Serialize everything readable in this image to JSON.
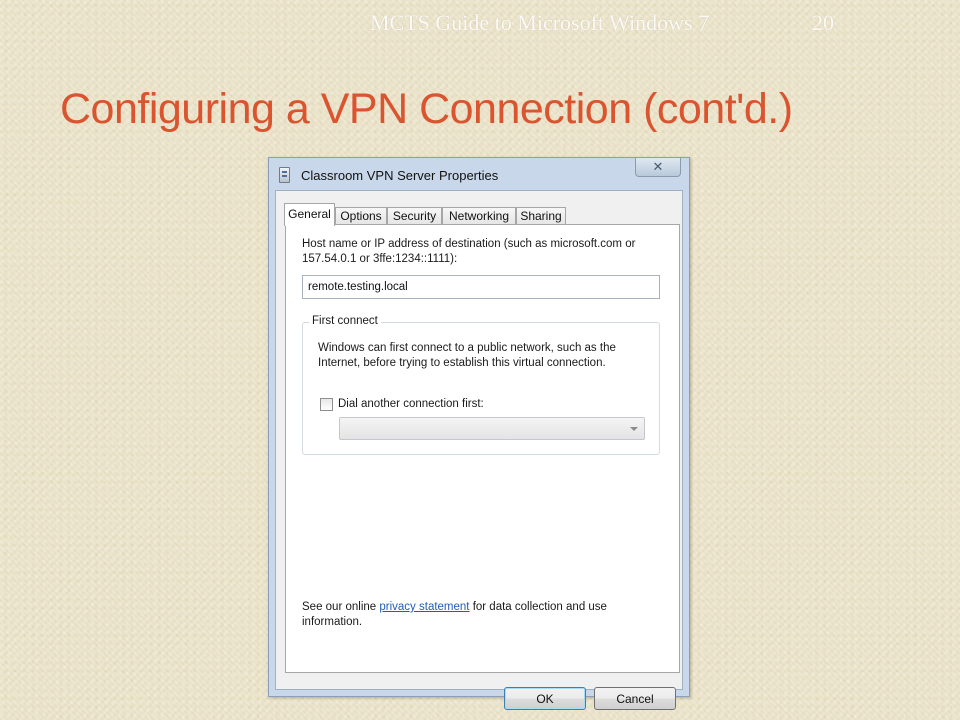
{
  "slide": {
    "footer": "MCTS Guide to Microsoft Windows 7",
    "page_number": "20",
    "title": "Configuring a VPN Connection (cont'd.)",
    "title_color": "#d9542f"
  },
  "dialog": {
    "title": "Classroom VPN Server Properties",
    "close_glyph": "✕",
    "tabs": [
      {
        "label": "General",
        "active": true
      },
      {
        "label": "Options",
        "active": false
      },
      {
        "label": "Security",
        "active": false
      },
      {
        "label": "Networking",
        "active": false
      },
      {
        "label": "Sharing",
        "active": false
      }
    ],
    "general": {
      "host_label": "Host name or IP address of destination (such as microsoft.com or 157.54.0.1 or 3ffe:1234::1111):",
      "host_value": "remote.testing.local",
      "first_connect": {
        "legend": "First connect",
        "description": "Windows can first connect to a public network, such as the Internet, before trying to establish this virtual connection.",
        "checkbox_label": "Dial another connection first:",
        "checkbox_checked": false,
        "combo_value": ""
      },
      "privacy": {
        "prefix": "See our online ",
        "link": "privacy statement",
        "suffix": " for data collection and use information."
      }
    },
    "buttons": {
      "ok": "OK",
      "cancel": "Cancel"
    }
  }
}
